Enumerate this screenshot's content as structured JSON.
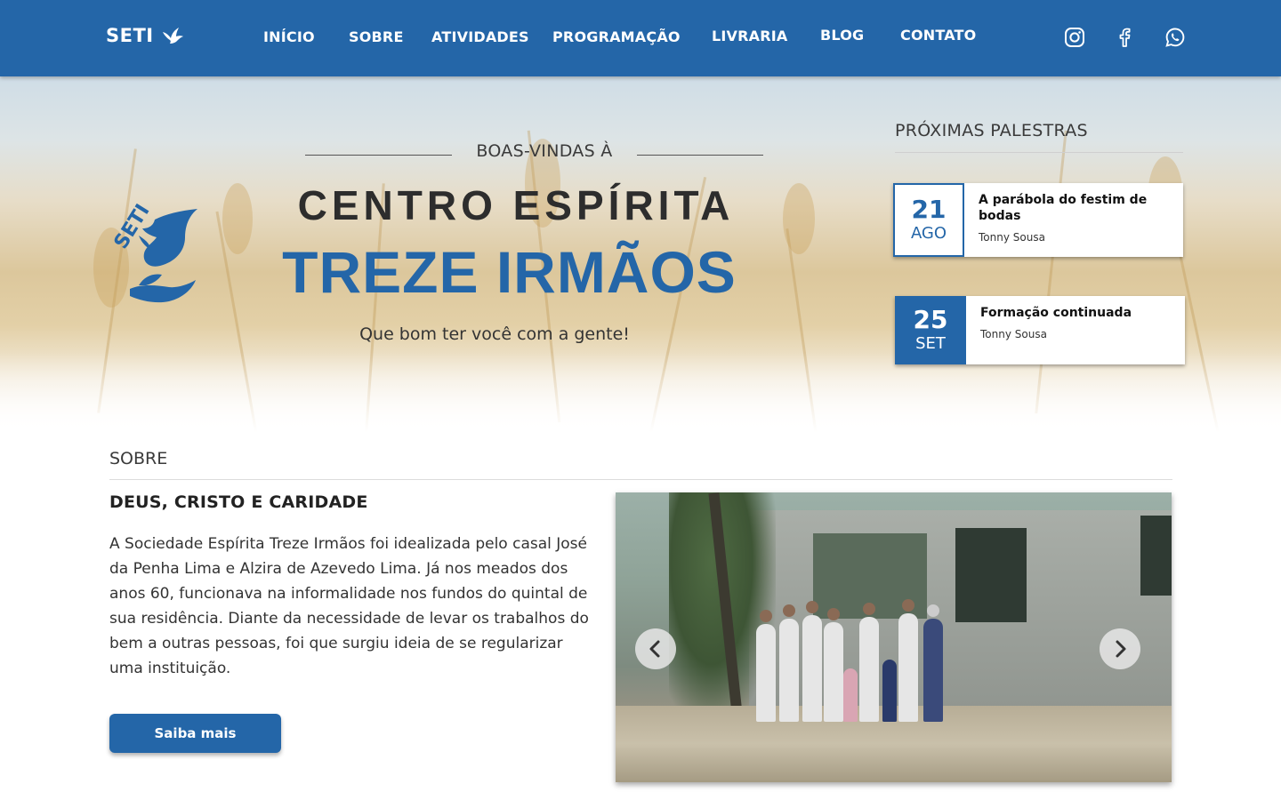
{
  "brand": {
    "name": "SETI",
    "icon": "dove-icon"
  },
  "nav": {
    "items": [
      {
        "label": "INÍCIO"
      },
      {
        "label": "SOBRE"
      },
      {
        "label": "ATIVIDADES"
      },
      {
        "label": "PROGRAMAÇÃO"
      },
      {
        "label": "LIVRARIA"
      },
      {
        "label": "BLOG"
      },
      {
        "label": "CONTATO"
      }
    ],
    "social": [
      "instagram-icon",
      "facebook-icon",
      "whatsapp-icon"
    ]
  },
  "hero": {
    "logo_text": "SETI",
    "welcome": "BOAS-VINDAS À",
    "title_line1": "CENTRO ESPÍRITA",
    "title_line2": "TREZE IRMÃOS",
    "tagline": "Que bom ter você com a gente!"
  },
  "upcoming": {
    "title": "PRÓXIMAS PALESTRAS",
    "events": [
      {
        "day": "21",
        "month": "AGO",
        "title": "A parábola do festim de bodas",
        "speaker": "Tonny Sousa"
      },
      {
        "day": "25",
        "month": "SET",
        "title": "Formação continuada",
        "speaker": "Tonny Sousa"
      }
    ]
  },
  "about": {
    "section_label": "SOBRE",
    "heading": "DEUS, CRISTO E CARIDADE",
    "body": "A Sociedade Espírita Treze Irmãos foi idealizada pelo casal José da Penha Lima e Alzira de Azevedo Lima. Já nos meados dos anos 60, funcionava na informalidade nos fundos do quintal de sua residência. Diante da necessidade de levar os trabalhos do bem a outras pessoas, foi que surgiu ideia de se regularizar uma instituição.",
    "button_label": "Saiba mais"
  },
  "colors": {
    "primary": "#2466a8",
    "text": "#333333"
  }
}
